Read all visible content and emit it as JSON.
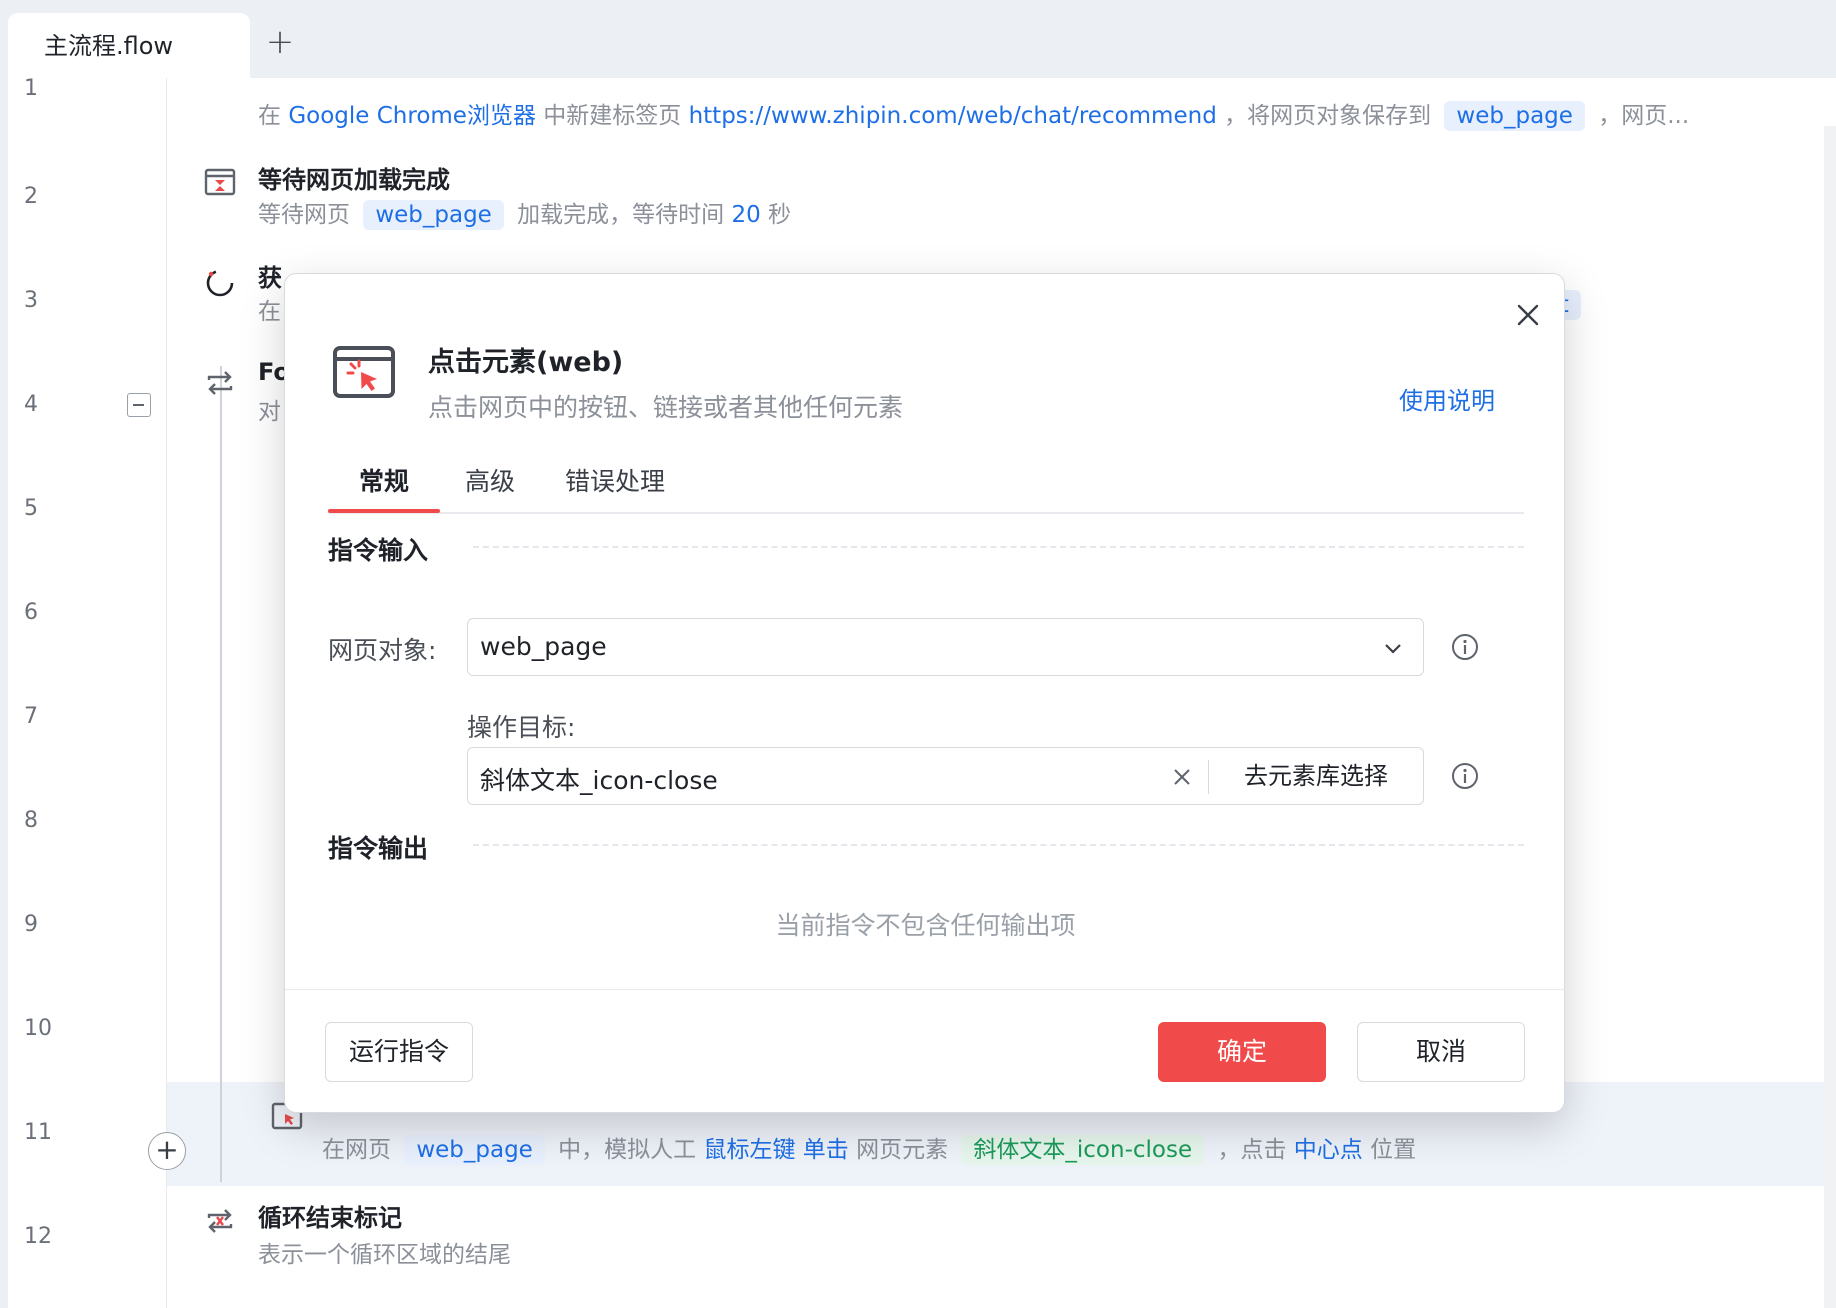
{
  "tabs": {
    "active_label": "主流程.flow",
    "add_label": "+"
  },
  "line_numbers": [
    "1",
    "2",
    "3",
    "4",
    "5",
    "6",
    "7",
    "8",
    "9",
    "10",
    "11",
    "12"
  ],
  "steps": {
    "s1": {
      "desc_p1": "在",
      "browser": "Google Chrome浏览器",
      "desc_p2": "中新建标签页",
      "url": "https://www.zhipin.com/web/chat/recommend",
      "desc_p3": "，将网页对象保存到",
      "var": "web_page",
      "desc_p4": "，网页..."
    },
    "s2": {
      "title": "等待网页加载完成",
      "desc_p1": "等待网页",
      "var": "web_page",
      "desc_p2": "加载完成，等待时间",
      "seconds": "20",
      "desc_p3": "秒"
    },
    "s3": {
      "title_visible": "获",
      "desc_visible": "在",
      "var_tail": "list"
    },
    "s4": {
      "title_visible": "Fo",
      "desc_visible": "对"
    },
    "s11": {
      "desc_p1": "在网页",
      "var": "web_page",
      "desc_p2": "中，模拟人工",
      "mouse": "鼠标左键",
      "click": "单击",
      "desc_p3": "网页元素",
      "element": "斜体文本_icon-close",
      "desc_p4": "，点击",
      "pos": "中心点",
      "desc_p5": "位置"
    },
    "s12": {
      "title": "循环结束标记",
      "desc": "表示一个循环区域的结尾"
    }
  },
  "dialog": {
    "title": "点击元素(web)",
    "subtitle": "点击网页中的按钮、链接或者其他任何元素",
    "help_link": "使用说明",
    "tabs": [
      "常规",
      "高级",
      "错误处理"
    ],
    "input_section": "指令输入",
    "web_object_label": "网页对象:",
    "web_object_value": "web_page",
    "target_label": "操作目标:",
    "target_value": "斜体文本_icon-close",
    "target_lib_button": "去元素库选择",
    "output_section": "指令输出",
    "output_empty": "当前指令不包含任何输出项",
    "run_button": "运行指令",
    "ok_button": "确定",
    "cancel_button": "取消"
  },
  "colors": {
    "accent": "#f04a4a",
    "link": "#1e6fe6",
    "variable_bg": "#e8f0fd",
    "element_green": "#1d9a5b"
  },
  "icons": {
    "dialog": "click-element-icon",
    "close": "close-icon",
    "chevron": "chevron-down-icon",
    "clear": "clear-icon",
    "info": "info-icon",
    "wait": "wait-page-icon",
    "loading": "loading-icon",
    "loop": "loop-icon",
    "loop_end": "loop-end-icon"
  }
}
